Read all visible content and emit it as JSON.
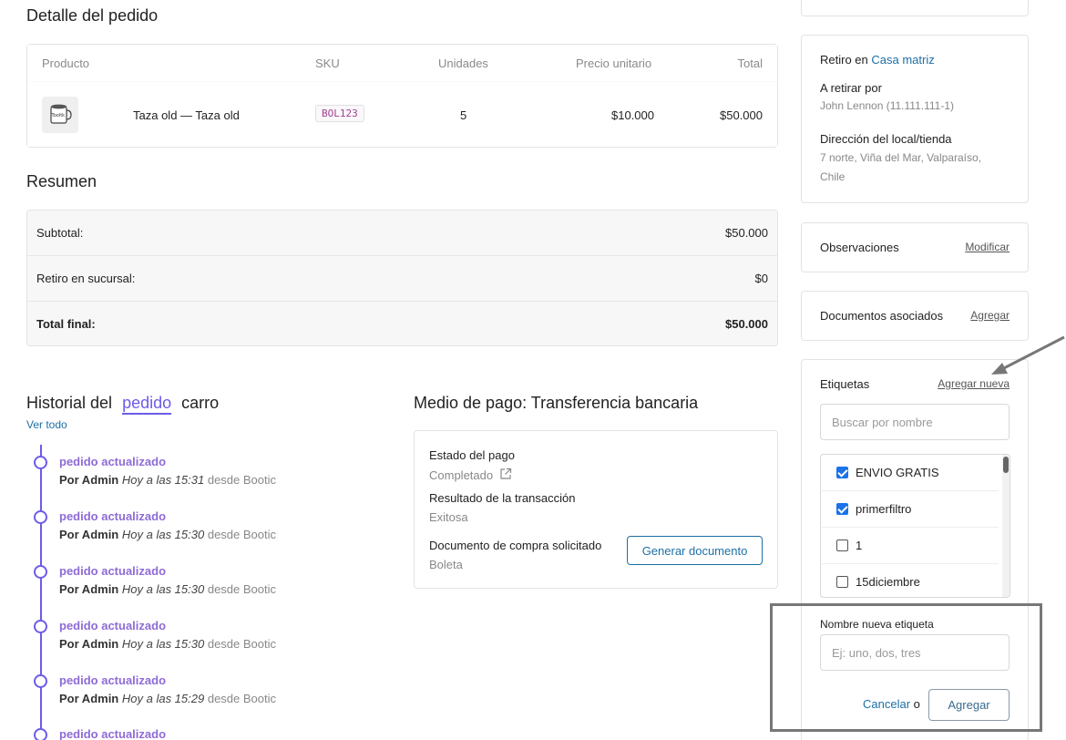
{
  "order_detail": {
    "title": "Detalle del pedido",
    "columns": [
      "Producto",
      "SKU",
      "Unidades",
      "Precio unitario",
      "Total"
    ],
    "product": {
      "thumb_text": "Tooltk",
      "name": "Taza old — Taza old",
      "sku": "BOL123",
      "units": "5",
      "unit_price": "$10.000",
      "total": "$50.000"
    }
  },
  "summary": {
    "title": "Resumen",
    "rows": [
      {
        "label": "Subtotal:",
        "value": "$50.000"
      },
      {
        "label": "Retiro en sucursal:",
        "value": "$0"
      },
      {
        "label": "Total final:",
        "value": "$50.000"
      }
    ]
  },
  "history": {
    "title_prefix": "Historial del",
    "tab_active": "pedido",
    "tab_other": "carro",
    "see_all": "Ver todo",
    "items": [
      {
        "title": "pedido actualizado",
        "by": "Por Admin",
        "when": "Hoy a las 15:31",
        "source": "desde Bootic"
      },
      {
        "title": "pedido actualizado",
        "by": "Por Admin",
        "when": "Hoy a las 15:30",
        "source": "desde Bootic"
      },
      {
        "title": "pedido actualizado",
        "by": "Por Admin",
        "when": "Hoy a las 15:30",
        "source": "desde Bootic"
      },
      {
        "title": "pedido actualizado",
        "by": "Por Admin",
        "when": "Hoy a las 15:30",
        "source": "desde Bootic"
      },
      {
        "title": "pedido actualizado",
        "by": "Por Admin",
        "when": "Hoy a las 15:29",
        "source": "desde Bootic"
      },
      {
        "title": "pedido actualizado",
        "by": "",
        "when": "",
        "source": ""
      }
    ]
  },
  "payment": {
    "title": "Medio de pago: Transferencia bancaria",
    "status_label": "Estado del pago",
    "status_value": "Completado",
    "result_label": "Resultado de la transacción",
    "result_value": "Exitosa",
    "doc_label": "Documento de compra solicitado",
    "doc_value": "Boleta",
    "generate_button": "Generar documento"
  },
  "pickup": {
    "prefix": "Retiro en",
    "location": "Casa matriz",
    "who_label": "A retirar por",
    "who_value": "John Lennon (11.111.111-1)",
    "address_label": "Dirección del local/tienda",
    "address_line1": "7 norte, Viña del Mar, Valparaíso,",
    "address_line2": "Chile"
  },
  "observations": {
    "title": "Observaciones",
    "action": "Modificar"
  },
  "documents": {
    "title": "Documentos asociados",
    "action": "Agregar"
  },
  "tags": {
    "title": "Etiquetas",
    "add_new": "Agregar nueva",
    "search_placeholder": "Buscar por nombre",
    "items": [
      {
        "label": "ENVIO GRATIS",
        "checked": true
      },
      {
        "label": "primerfiltro",
        "checked": true
      },
      {
        "label": "1",
        "checked": false
      },
      {
        "label": "15diciembre",
        "checked": false
      }
    ],
    "new_label": "Nombre nueva etiqueta",
    "new_placeholder": "Ej: uno, dos, tres",
    "cancel": "Cancelar",
    "or": "o",
    "add_button": "Agregar"
  },
  "colors": {
    "accent_purple": "#6c5ce7",
    "link_blue": "#1d6fa5",
    "annotation_gray": "#777777"
  }
}
